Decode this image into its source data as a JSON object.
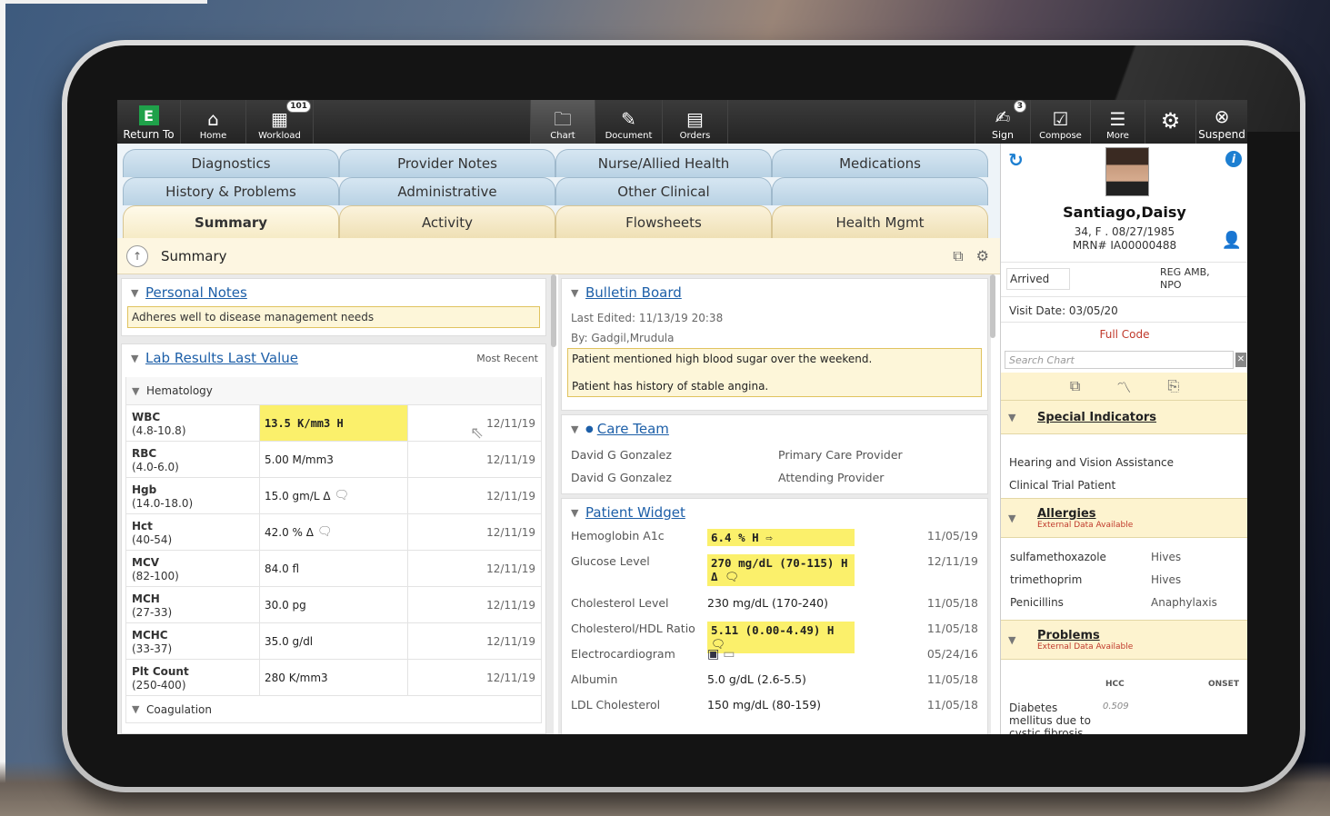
{
  "toolbar": {
    "left": [
      {
        "name": "return-to-button",
        "label": "Return To",
        "icon": "E"
      },
      {
        "name": "home-button",
        "label": "Home",
        "icon": "home-icon"
      },
      {
        "name": "workload-button",
        "label": "Workload",
        "icon": "calendar-icon",
        "badge": "101"
      }
    ],
    "center": [
      {
        "name": "chart-button",
        "label": "Chart",
        "icon": "folder-icon"
      },
      {
        "name": "document-button",
        "label": "Document",
        "icon": "pencil-icon"
      },
      {
        "name": "orders-button",
        "label": "Orders",
        "icon": "clipboard-icon"
      }
    ],
    "right": [
      {
        "name": "sign-button",
        "label": "Sign",
        "icon": "signature-icon",
        "badge": "3"
      },
      {
        "name": "compose-button",
        "label": "Compose",
        "icon": "compose-icon"
      },
      {
        "name": "more-button",
        "label": "More",
        "icon": "list-icon"
      },
      {
        "name": "settings-button",
        "label": "",
        "icon": "gear-icon"
      },
      {
        "name": "suspend-button",
        "label": "Suspend",
        "icon": "close-circle-icon"
      }
    ]
  },
  "tabs": {
    "row1": [
      "Diagnostics",
      "Provider Notes",
      "Nurse/Allied Health",
      "Medications"
    ],
    "row2": [
      "History & Problems",
      "Administrative",
      "Other Clinical",
      ""
    ],
    "row3": [
      "Summary",
      "Activity",
      "Flowsheets",
      "Health Mgmt"
    ]
  },
  "summary_bar": {
    "title": "Summary"
  },
  "personal_notes": {
    "title": "Personal Notes",
    "note": "Adheres well to disease management needs"
  },
  "lab_results": {
    "title": "Lab Results Last Value",
    "header_right": "Most Recent",
    "group": "Hematology",
    "group2": "Coagulation",
    "rows": [
      {
        "name": "WBC",
        "range": "(4.8-10.8)",
        "value": "13.5 K/mm3 H",
        "date": "12/11/19",
        "hl": true
      },
      {
        "name": "RBC",
        "range": "(4.0-6.0)",
        "value": "5.00 M/mm3",
        "date": "12/11/19"
      },
      {
        "name": "Hgb",
        "range": "(14.0-18.0)",
        "value": "15.0 gm/L Δ",
        "date": "12/11/19",
        "comment": true
      },
      {
        "name": "Hct",
        "range": "(40-54)",
        "value": "42.0 % Δ",
        "date": "12/11/19",
        "comment": true
      },
      {
        "name": "MCV",
        "range": "(82-100)",
        "value": "84.0 fl",
        "date": "12/11/19"
      },
      {
        "name": "MCH",
        "range": "(27-33)",
        "value": "30.0 pg",
        "date": "12/11/19"
      },
      {
        "name": "MCHC",
        "range": "(33-37)",
        "value": "35.0 g/dl",
        "date": "12/11/19"
      },
      {
        "name": "Plt Count",
        "range": "(250-400)",
        "value": "280 K/mm3",
        "date": "12/11/19"
      }
    ]
  },
  "bulletin": {
    "title": "Bulletin Board",
    "edited": "Last Edited: 11/13/19 20:38",
    "by": "By: Gadgil,Mrudula",
    "line1": "Patient mentioned high blood sugar over the weekend.",
    "line2": "Patient has history of stable angina."
  },
  "care_team": {
    "title": "Care Team",
    "members": [
      {
        "name": "David G Gonzalez",
        "role": "Primary Care Provider"
      },
      {
        "name": "David G Gonzalez",
        "role": "Attending Provider"
      }
    ]
  },
  "widget": {
    "title": "Patient Widget",
    "rows": [
      {
        "name": "Hemoglobin A1c",
        "value": "6.4 % H",
        "date": "11/05/19",
        "hl": true
      },
      {
        "name": "Glucose Level",
        "value": "270 mg/dL (70-115) H",
        "value2": "Δ",
        "date": "12/11/19",
        "hl": true
      },
      {
        "name": "Cholesterol Level",
        "value": "230 mg/dL (170-240)",
        "date": "11/05/18"
      },
      {
        "name": "Cholesterol/HDL Ratio",
        "value": "5.11 (0.00-4.49) H",
        "date": "11/05/18",
        "hl": true
      },
      {
        "name": "Electrocardiogram",
        "value": "",
        "date": "05/24/16"
      },
      {
        "name": "Albumin",
        "value": "5.0 g/dL (2.6-5.5)",
        "date": "11/05/18"
      },
      {
        "name": "LDL Cholesterol",
        "value": "150 mg/dL (80-159)",
        "date": "11/05/18"
      }
    ]
  },
  "patient": {
    "name": "Santiago,Daisy",
    "demo": "34, F . 08/27/1985",
    "mrn": "MRN# IA00000488",
    "status": "Arrived",
    "visit_type": "REG AMB,",
    "visit_type2": "NPO",
    "visit_date": "Visit Date: 03/05/20",
    "code": "Full Code",
    "search_placeholder": "Search Chart"
  },
  "special_indicators": {
    "title": "Special Indicators",
    "items": [
      "Hearing and Vision Assistance",
      "Clinical Trial Patient"
    ]
  },
  "allergies": {
    "title": "Allergies",
    "sub": "External Data Available",
    "items": [
      {
        "name": "sulfamethoxazole",
        "reaction": "Hives"
      },
      {
        "name": "trimethoprim",
        "reaction": "Hives"
      },
      {
        "name": "Penicillins",
        "reaction": "Anaphylaxis"
      }
    ]
  },
  "problems": {
    "title": "Problems",
    "sub": "External Data Available",
    "col1": "HCC",
    "col2": "ONSET",
    "item": "Diabetes",
    "item2": "mellitus due to",
    "item3": "cystic fibrosis",
    "hcc": "0.509"
  },
  "colors": {
    "accent": "#1d5fa8",
    "highlight": "#fbf06b",
    "alert": "#c0392b"
  }
}
